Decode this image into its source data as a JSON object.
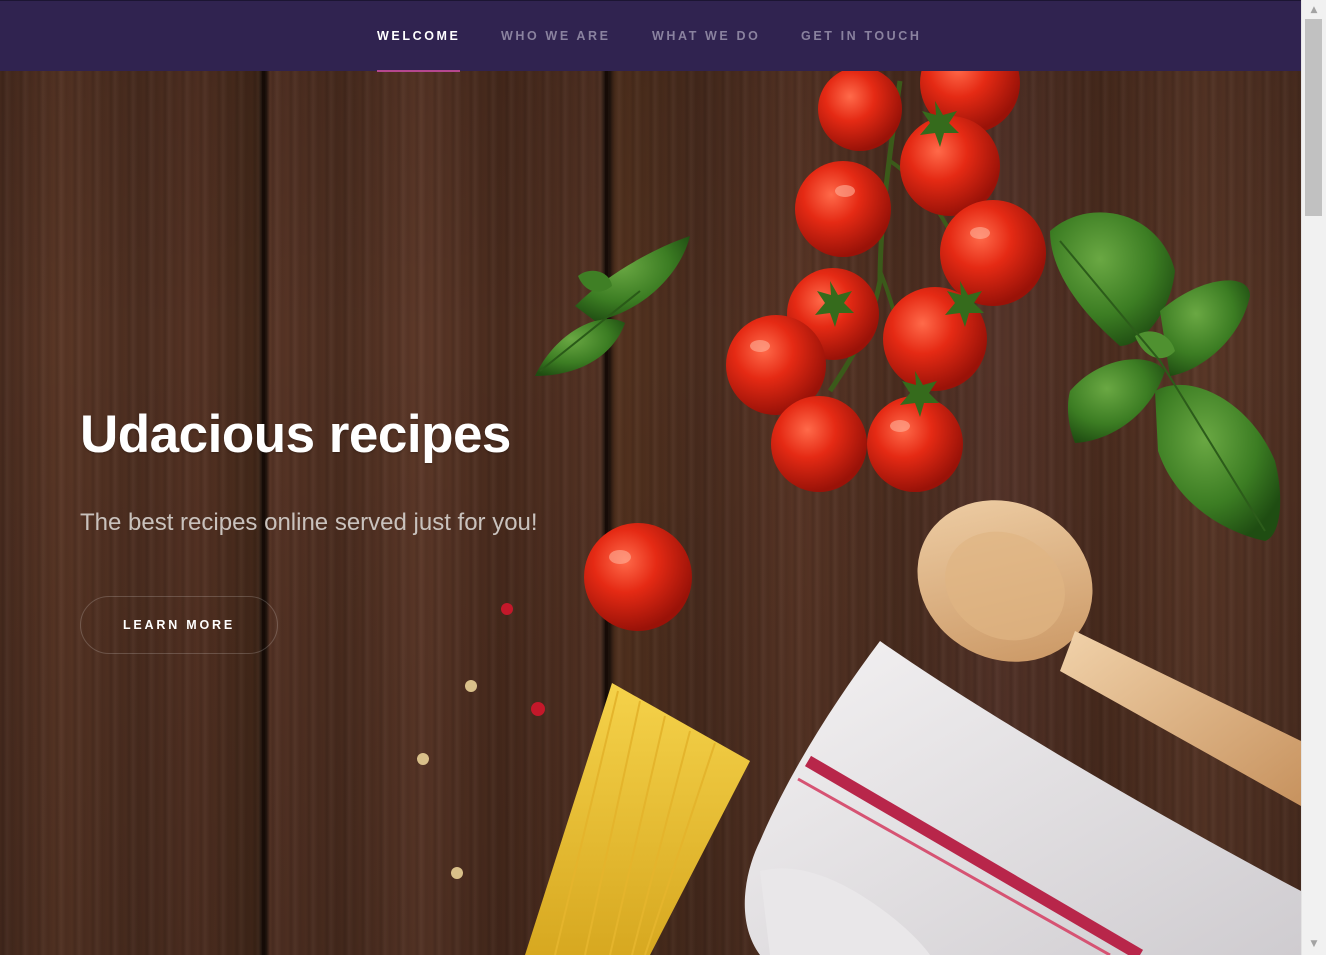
{
  "nav": {
    "items": [
      {
        "label": "WELCOME",
        "active": true
      },
      {
        "label": "WHO WE ARE",
        "active": false
      },
      {
        "label": "WHAT WE DO",
        "active": false
      },
      {
        "label": "GET IN TOUCH",
        "active": false
      }
    ]
  },
  "hero": {
    "title": "Udacious recipes",
    "subtitle": "The best recipes online served just for you!",
    "button_label": "LEARN MORE"
  },
  "scrollbar": {
    "up_icon": "▲",
    "down_icon": "▼"
  },
  "colors": {
    "nav_background": "#302350",
    "nav_active_underline": "#b5478f",
    "nav_inactive_text": "#8a829f",
    "hero_title": "#ffffff"
  }
}
